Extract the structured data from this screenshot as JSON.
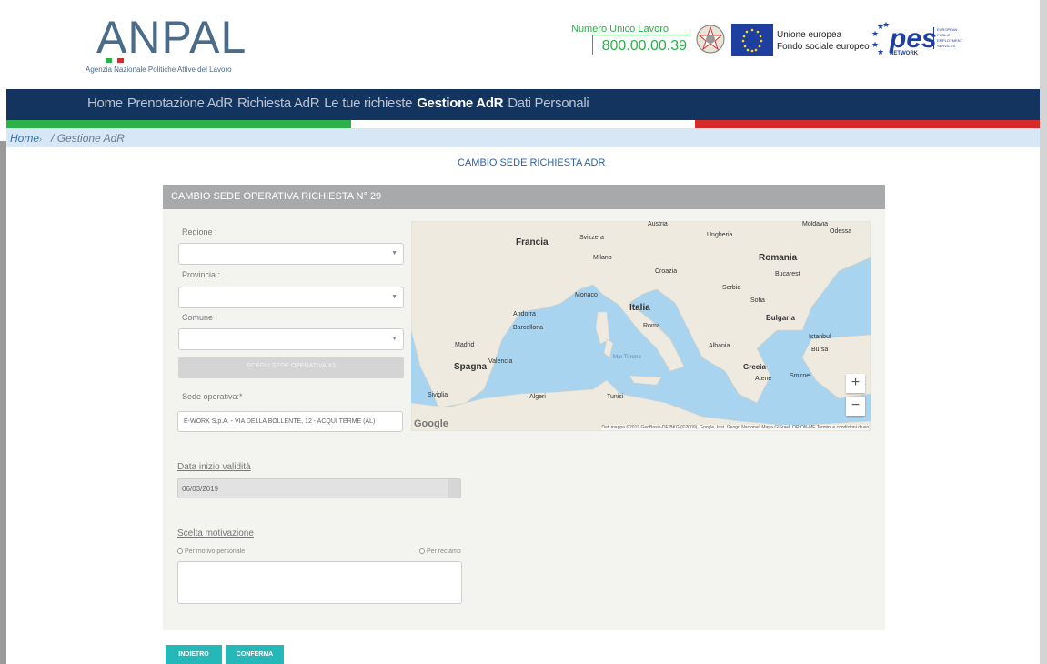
{
  "header": {
    "logo_text": "ANPAL",
    "logo_subtitle": "Agenzia Nazionale Politiche Attive del Lavoro",
    "numero_title": "Numero Unico Lavoro",
    "numero_value": "800.00.00.39",
    "eu_line1": "Unione europea",
    "eu_line2": "Fondo sociale europeo",
    "pes_logo": "pes",
    "pes_network": "NETWORK",
    "pes_side": "EUROPEAN PUBLIC EMPLOYMENT SERVICES"
  },
  "nav": {
    "items": [
      "Home",
      "Prenotazione AdR",
      "Richiesta AdR",
      "Le tue richieste",
      "Gestione AdR",
      "Dati Personali"
    ],
    "active": "Gestione AdR"
  },
  "breadcrumb": {
    "home": "Home",
    "sep": "›",
    "current": "/ Gestione AdR"
  },
  "page": {
    "title": "CAMBIO SEDE RICHIESTA ADR"
  },
  "panel": {
    "title": "CAMBIO SEDE OPERATIVA RICHIESTA N° 29",
    "regione_label": "Regione :",
    "provincia_label": "Provincia :",
    "comune_label": "Comune :",
    "scegli_button": "SCEGLI SEDE OPERATIVA X3",
    "sede_label": "Sede operativa:*",
    "sede_value": "E-WORK S.p.A. - VIA DELLA BOLLENTE, 12 - ACQUI TERME (AL)",
    "data_label": "Data inizio validità",
    "data_value": "06/03/2019",
    "motivazione_label": "Scelta motivazione",
    "radio_personale": "Per motivo personale",
    "radio_reclamo": "Per reclamo"
  },
  "map": {
    "labels": {
      "francia": "Francia",
      "italia": "Italia",
      "spagna": "Spagna",
      "romania": "Romania",
      "grecia": "Grecia",
      "bulgaria": "Bulgaria",
      "svizzera": "Svizzera",
      "austria": "Austria",
      "ungheria": "Ungheria",
      "milano": "Milano",
      "roma": "Roma",
      "madrid": "Madrid",
      "barcellona": "Barcellona",
      "valencia": "Valencia",
      "algeri": "Algeri",
      "tunisi": "Tunisi",
      "atene": "Atene",
      "istanbul": "Istanbul",
      "bucarest": "Bucarest",
      "croazia": "Croazia",
      "serbia": "Serbia",
      "albania": "Albania",
      "monaco": "Monaco",
      "andorra": "Andorra",
      "siviglia": "Siviglia",
      "sofia": "Sofia",
      "mar_tirreno": "Mar Tirreno",
      "moldavia": "Moldavia",
      "odessa": "Odessa",
      "smirne": "Smirne",
      "bursa": "Bursa"
    },
    "zoom_in": "+",
    "zoom_out": "−",
    "google": "Google",
    "attribution": "Dati mappa ©2019 GeoBasis-DE/BKG (©2009), Google, Inst. Geogr. Nacional, Mapa GISrael, ORION-ME  Termini e condizioni d'uso"
  },
  "buttons": {
    "indietro": "INDIETRO",
    "conferma": "CONFERMA"
  },
  "colors": {
    "nav": "#13345e",
    "accent": "#25b8b8",
    "green": "#2bb04a",
    "red": "#d62b2b"
  }
}
